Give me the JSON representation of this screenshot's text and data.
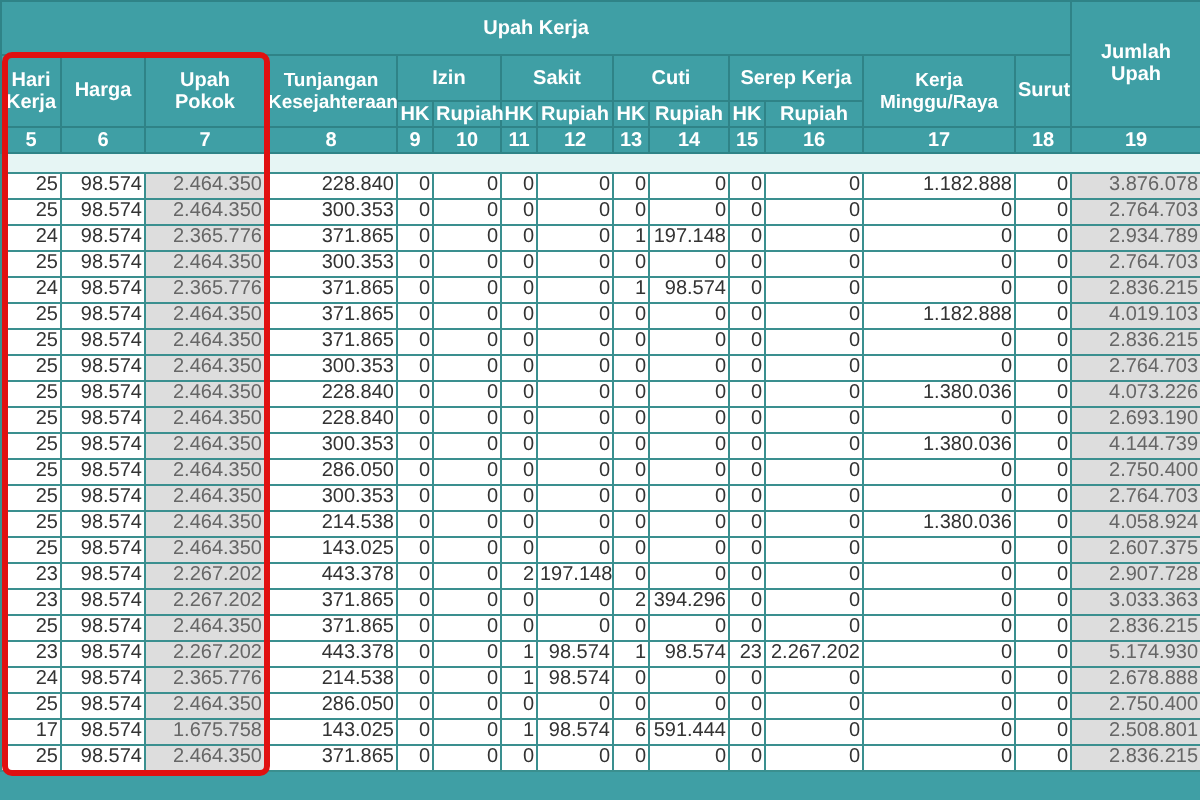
{
  "highlight_frame": {
    "visible": true
  },
  "table": {
    "group_title": "Upah Kerja",
    "total_title": "Jumlah Upah",
    "headings": [
      {
        "kind": "single",
        "label": "Hari Kerja"
      },
      {
        "kind": "single",
        "label": "Harga"
      },
      {
        "kind": "single",
        "label": "Upah Pokok"
      },
      {
        "kind": "single",
        "label": "Tunjangan Kesejahteraan"
      },
      {
        "kind": "pair",
        "label": "Izin",
        "sub_labels": [
          "HK",
          "Rupiah"
        ]
      },
      {
        "kind": "pair",
        "label": "Sakit",
        "sub_labels": [
          "HK",
          "Rupiah"
        ]
      },
      {
        "kind": "pair",
        "label": "Cuti",
        "sub_labels": [
          "HK",
          "Rupiah"
        ]
      },
      {
        "kind": "pair",
        "label": "Serep Kerja",
        "sub_labels": [
          "HK",
          "Rupiah"
        ]
      },
      {
        "kind": "single",
        "label": "Kerja Minggu/Raya"
      },
      {
        "kind": "single",
        "label": "Surut"
      }
    ],
    "column_numbers": [
      {
        "label": "5",
        "shaded": false
      },
      {
        "label": "6",
        "shaded": false
      },
      {
        "label": "7",
        "shaded": true
      },
      {
        "label": "8",
        "shaded": false
      },
      {
        "label": "9",
        "shaded": false
      },
      {
        "label": "10",
        "shaded": false
      },
      {
        "label": "11",
        "shaded": false
      },
      {
        "label": "12",
        "shaded": false
      },
      {
        "label": "13",
        "shaded": false
      },
      {
        "label": "14",
        "shaded": false
      },
      {
        "label": "15",
        "shaded": false
      },
      {
        "label": "16",
        "shaded": false
      },
      {
        "label": "17",
        "shaded": false
      },
      {
        "label": "18",
        "shaded": false
      },
      {
        "label": "19",
        "shaded": true
      }
    ],
    "rows": [
      [
        "25",
        "98.574",
        "2.464.350",
        "228.840",
        "0",
        "0",
        "0",
        "0",
        "0",
        "0",
        "0",
        "0",
        "1.182.888",
        "0",
        "3.876.078"
      ],
      [
        "25",
        "98.574",
        "2.464.350",
        "300.353",
        "0",
        "0",
        "0",
        "0",
        "0",
        "0",
        "0",
        "0",
        "0",
        "0",
        "2.764.703"
      ],
      [
        "24",
        "98.574",
        "2.365.776",
        "371.865",
        "0",
        "0",
        "0",
        "0",
        "1",
        "197.148",
        "0",
        "0",
        "0",
        "0",
        "2.934.789"
      ],
      [
        "25",
        "98.574",
        "2.464.350",
        "300.353",
        "0",
        "0",
        "0",
        "0",
        "0",
        "0",
        "0",
        "0",
        "0",
        "0",
        "2.764.703"
      ],
      [
        "24",
        "98.574",
        "2.365.776",
        "371.865",
        "0",
        "0",
        "0",
        "0",
        "1",
        "98.574",
        "0",
        "0",
        "0",
        "0",
        "2.836.215"
      ],
      [
        "25",
        "98.574",
        "2.464.350",
        "371.865",
        "0",
        "0",
        "0",
        "0",
        "0",
        "0",
        "0",
        "0",
        "1.182.888",
        "0",
        "4.019.103"
      ],
      [
        "25",
        "98.574",
        "2.464.350",
        "371.865",
        "0",
        "0",
        "0",
        "0",
        "0",
        "0",
        "0",
        "0",
        "0",
        "0",
        "2.836.215"
      ],
      [
        "25",
        "98.574",
        "2.464.350",
        "300.353",
        "0",
        "0",
        "0",
        "0",
        "0",
        "0",
        "0",
        "0",
        "0",
        "0",
        "2.764.703"
      ],
      [
        "25",
        "98.574",
        "2.464.350",
        "228.840",
        "0",
        "0",
        "0",
        "0",
        "0",
        "0",
        "0",
        "0",
        "1.380.036",
        "0",
        "4.073.226"
      ],
      [
        "25",
        "98.574",
        "2.464.350",
        "228.840",
        "0",
        "0",
        "0",
        "0",
        "0",
        "0",
        "0",
        "0",
        "0",
        "0",
        "2.693.190"
      ],
      [
        "25",
        "98.574",
        "2.464.350",
        "300.353",
        "0",
        "0",
        "0",
        "0",
        "0",
        "0",
        "0",
        "0",
        "1.380.036",
        "0",
        "4.144.739"
      ],
      [
        "25",
        "98.574",
        "2.464.350",
        "286.050",
        "0",
        "0",
        "0",
        "0",
        "0",
        "0",
        "0",
        "0",
        "0",
        "0",
        "2.750.400"
      ],
      [
        "25",
        "98.574",
        "2.464.350",
        "300.353",
        "0",
        "0",
        "0",
        "0",
        "0",
        "0",
        "0",
        "0",
        "0",
        "0",
        "2.764.703"
      ],
      [
        "25",
        "98.574",
        "2.464.350",
        "214.538",
        "0",
        "0",
        "0",
        "0",
        "0",
        "0",
        "0",
        "0",
        "1.380.036",
        "0",
        "4.058.924"
      ],
      [
        "25",
        "98.574",
        "2.464.350",
        "143.025",
        "0",
        "0",
        "0",
        "0",
        "0",
        "0",
        "0",
        "0",
        "0",
        "0",
        "2.607.375"
      ],
      [
        "23",
        "98.574",
        "2.267.202",
        "443.378",
        "0",
        "0",
        "2",
        "197.148",
        "0",
        "0",
        "0",
        "0",
        "0",
        "0",
        "2.907.728"
      ],
      [
        "23",
        "98.574",
        "2.267.202",
        "371.865",
        "0",
        "0",
        "0",
        "0",
        "2",
        "394.296",
        "0",
        "0",
        "0",
        "0",
        "3.033.363"
      ],
      [
        "25",
        "98.574",
        "2.464.350",
        "371.865",
        "0",
        "0",
        "0",
        "0",
        "0",
        "0",
        "0",
        "0",
        "0",
        "0",
        "2.836.215"
      ],
      [
        "23",
        "98.574",
        "2.267.202",
        "443.378",
        "0",
        "0",
        "1",
        "98.574",
        "1",
        "98.574",
        "23",
        "2.267.202",
        "0",
        "0",
        "5.174.930"
      ],
      [
        "24",
        "98.574",
        "2.365.776",
        "214.538",
        "0",
        "0",
        "1",
        "98.574",
        "0",
        "0",
        "0",
        "0",
        "0",
        "0",
        "2.678.888"
      ],
      [
        "25",
        "98.574",
        "2.464.350",
        "286.050",
        "0",
        "0",
        "0",
        "0",
        "0",
        "0",
        "0",
        "0",
        "0",
        "0",
        "2.750.400"
      ],
      [
        "17",
        "98.574",
        "1.675.758",
        "143.025",
        "0",
        "0",
        "1",
        "98.574",
        "6",
        "591.444",
        "0",
        "0",
        "0",
        "0",
        "2.508.801"
      ],
      [
        "25",
        "98.574",
        "2.464.350",
        "371.865",
        "0",
        "0",
        "0",
        "0",
        "0",
        "0",
        "0",
        "0",
        "0",
        "0",
        "2.836.215"
      ]
    ]
  }
}
